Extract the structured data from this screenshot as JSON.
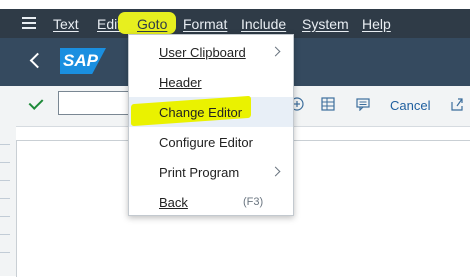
{
  "menubar": {
    "items": [
      {
        "label": "Text"
      },
      {
        "label": "Edit"
      },
      {
        "label": "Goto"
      },
      {
        "label": "Format"
      },
      {
        "label": "Include"
      },
      {
        "label": "System"
      },
      {
        "label": "Help"
      }
    ]
  },
  "titlebar": {
    "logo_text": "SAP"
  },
  "toolbar": {
    "cancel_label": "Cancel"
  },
  "goto_menu": {
    "items": [
      {
        "label": "User Clipboard",
        "has_submenu": true
      },
      {
        "label": "Header"
      },
      {
        "label": "Change Editor",
        "selected": true
      },
      {
        "label": "Configure Editor"
      },
      {
        "label": "Print Program",
        "has_submenu": true
      },
      {
        "label": "Back",
        "shortcut": "(F3)"
      }
    ]
  },
  "colors": {
    "menubar_bg": "#2f3b47",
    "titlebar_bg": "#354a5f",
    "sap_blue": "#1a8fe0",
    "highlight_yellow": "#e7ef1f",
    "check_green": "#1e8a3a",
    "toolbar_link": "#1f5f9f"
  }
}
